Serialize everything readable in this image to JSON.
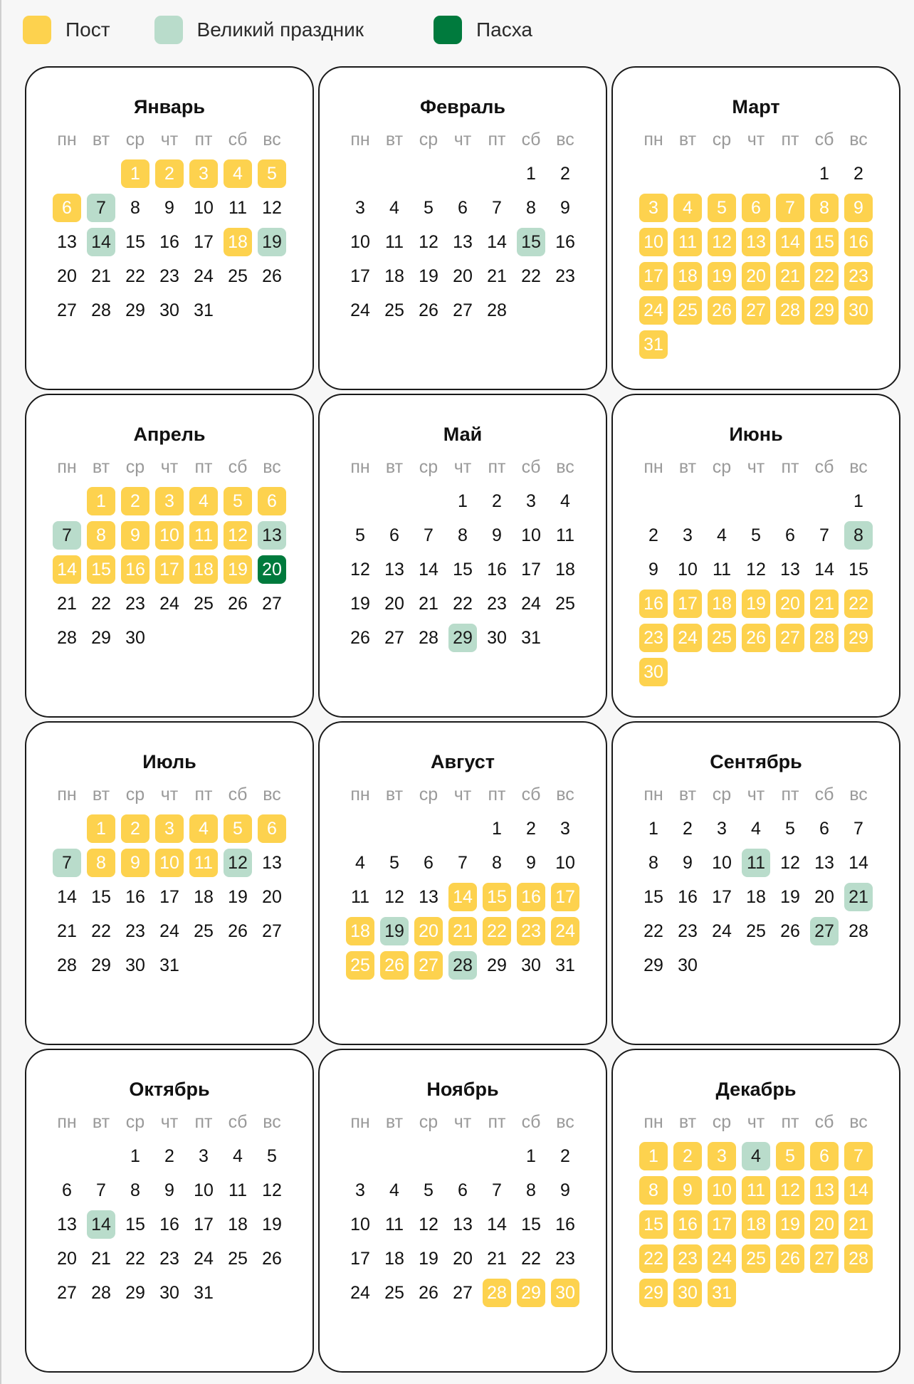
{
  "colors": {
    "fast": "#fdd24e",
    "feast": "#b9dccb",
    "easter": "#007a3d"
  },
  "legend": [
    {
      "label": "Пост",
      "type": "fast"
    },
    {
      "label": "Великий праздник",
      "type": "feast"
    },
    {
      "label": "Пасха",
      "type": "easter"
    }
  ],
  "weekdays": [
    "пн",
    "вт",
    "ср",
    "чт",
    "пт",
    "сб",
    "вс"
  ],
  "months": [
    {
      "name": "Январь",
      "offset": 2,
      "days": 31,
      "fast": [
        1,
        2,
        3,
        4,
        5,
        6,
        18
      ],
      "feast": [
        7,
        14,
        19
      ],
      "easter": []
    },
    {
      "name": "Февраль",
      "offset": 5,
      "days": 28,
      "fast": [],
      "feast": [
        15
      ],
      "easter": []
    },
    {
      "name": "Март",
      "offset": 5,
      "days": 31,
      "fast": [
        3,
        4,
        5,
        6,
        7,
        8,
        9,
        10,
        11,
        12,
        13,
        14,
        15,
        16,
        17,
        18,
        19,
        20,
        21,
        22,
        23,
        24,
        25,
        26,
        27,
        28,
        29,
        30,
        31
      ],
      "feast": [],
      "easter": []
    },
    {
      "name": "Апрель",
      "offset": 1,
      "days": 30,
      "fast": [
        1,
        2,
        3,
        4,
        5,
        6,
        8,
        9,
        10,
        11,
        12,
        14,
        15,
        16,
        17,
        18,
        19
      ],
      "feast": [
        7,
        13
      ],
      "easter": [
        20
      ]
    },
    {
      "name": "Май",
      "offset": 3,
      "days": 31,
      "fast": [],
      "feast": [
        29
      ],
      "easter": []
    },
    {
      "name": "Июнь",
      "offset": 6,
      "days": 30,
      "fast": [
        16,
        17,
        18,
        19,
        20,
        21,
        22,
        23,
        24,
        25,
        26,
        27,
        28,
        29,
        30
      ],
      "feast": [
        8
      ],
      "easter": []
    },
    {
      "name": "Июль",
      "offset": 1,
      "days": 31,
      "fast": [
        1,
        2,
        3,
        4,
        5,
        6,
        8,
        9,
        10,
        11
      ],
      "feast": [
        7,
        12
      ],
      "easter": []
    },
    {
      "name": "Август",
      "offset": 4,
      "days": 31,
      "fast": [
        14,
        15,
        16,
        17,
        18,
        20,
        21,
        22,
        23,
        24,
        25,
        26,
        27
      ],
      "feast": [
        19,
        28
      ],
      "easter": []
    },
    {
      "name": "Сентябрь",
      "offset": 0,
      "days": 30,
      "fast": [],
      "feast": [
        11,
        21,
        27
      ],
      "easter": []
    },
    {
      "name": "Октябрь",
      "offset": 2,
      "days": 31,
      "fast": [],
      "feast": [
        14
      ],
      "easter": []
    },
    {
      "name": "Ноябрь",
      "offset": 5,
      "days": 30,
      "fast": [
        28,
        29,
        30
      ],
      "feast": [],
      "easter": []
    },
    {
      "name": "Декабрь",
      "offset": 0,
      "days": 31,
      "fast": [
        1,
        2,
        3,
        5,
        6,
        7,
        8,
        9,
        10,
        11,
        12,
        13,
        14,
        15,
        16,
        17,
        18,
        19,
        20,
        21,
        22,
        23,
        24,
        25,
        26,
        27,
        28,
        29,
        30,
        31
      ],
      "feast": [
        4
      ],
      "easter": []
    }
  ]
}
